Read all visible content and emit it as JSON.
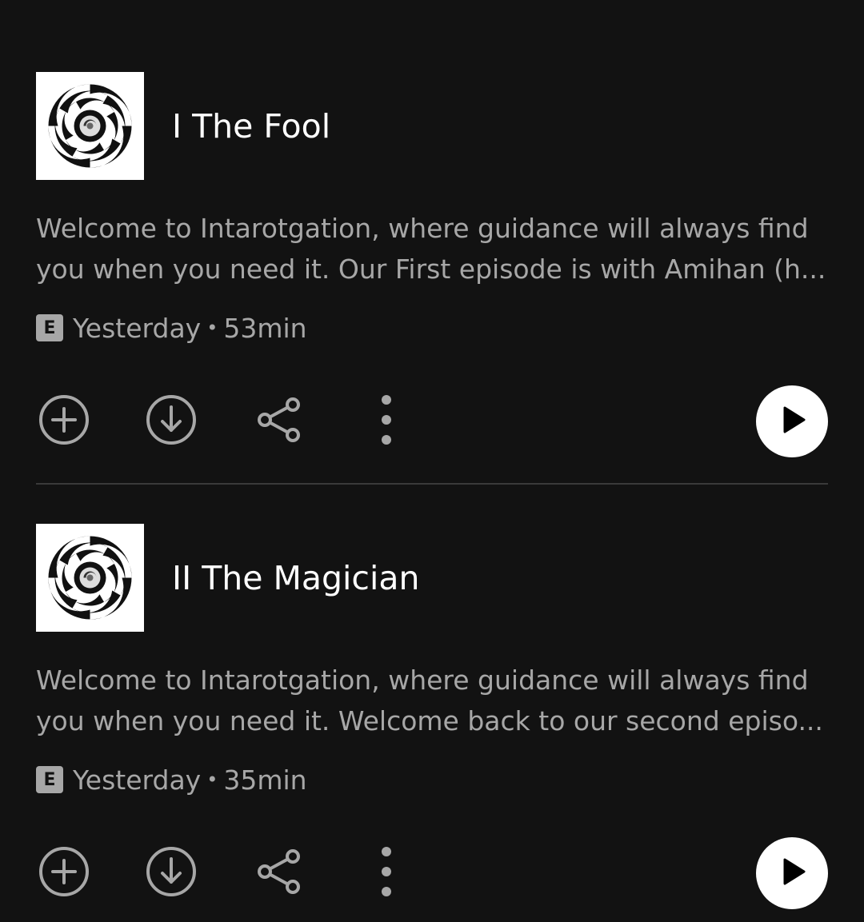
{
  "episodes": [
    {
      "title": "I The Fool",
      "description_line1": "Welcome to Intarotgation, where guidance will always find",
      "description_line2": "you when you need it. Our First episode is with Amihan (h...",
      "explicit_badge": "E",
      "date": "Yesterday",
      "separator": "•",
      "duration": "53min"
    },
    {
      "title": "II The Magician",
      "description_line1": "Welcome to Intarotgation, where guidance will always find",
      "description_line2": "you when you need it. Welcome back to our second episo...",
      "explicit_badge": "E",
      "date": "Yesterday",
      "separator": "•",
      "duration": "35min"
    }
  ],
  "icons": {
    "add": "add-circle-icon",
    "download": "download-circle-icon",
    "share": "share-icon",
    "more": "more-vertical-icon",
    "play": "play-icon"
  },
  "colors": {
    "background": "#121212",
    "title": "#ffffff",
    "secondary_text": "#a7a7a7",
    "divider": "#3a3a3a",
    "play_button": "#ffffff"
  }
}
